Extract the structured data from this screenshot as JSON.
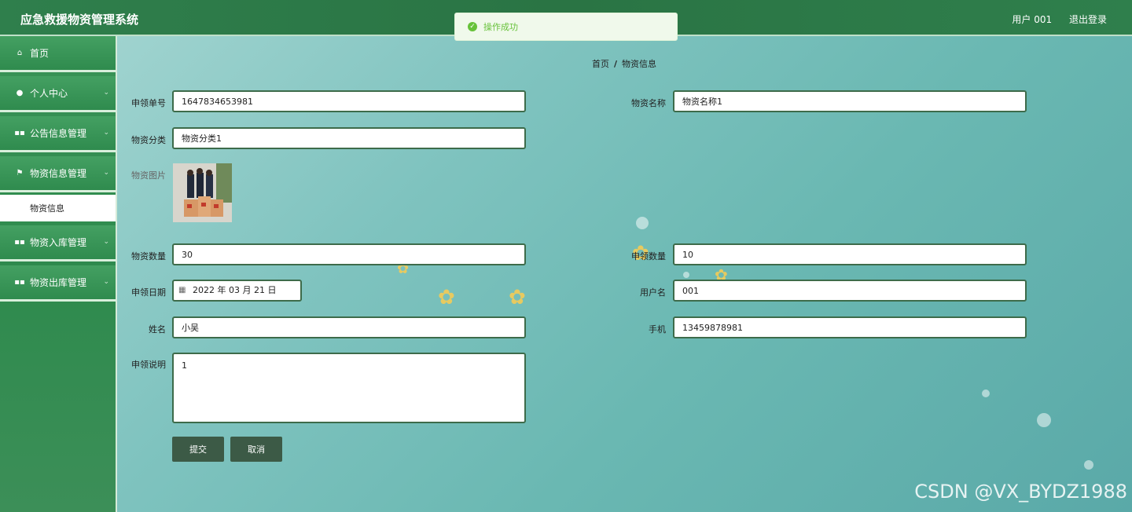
{
  "header": {
    "title": "应急救援物资管理系统",
    "user_label": "用户 001",
    "logout_label": "退出登录"
  },
  "toast": {
    "message": "操作成功"
  },
  "sidebar": {
    "items": [
      {
        "label": "首页",
        "icon": "home-icon"
      },
      {
        "label": "个人中心",
        "icon": "user-icon"
      },
      {
        "label": "公告信息管理",
        "icon": "grid-icon"
      },
      {
        "label": "物资信息管理",
        "icon": "flag-icon"
      },
      {
        "label": "物资入库管理",
        "icon": "grid-icon"
      },
      {
        "label": "物资出库管理",
        "icon": "grid-icon"
      }
    ],
    "sub_item": "物资信息"
  },
  "breadcrumb": {
    "home": "首页",
    "sep": "/",
    "current": "物资信息"
  },
  "form": {
    "order_no": {
      "label": "申领单号",
      "value": "1647834653981"
    },
    "material_name": {
      "label": "物资名称",
      "value": "物资名称1"
    },
    "category": {
      "label": "物资分类",
      "value": "物资分类1"
    },
    "photo": {
      "label": "物资图片"
    },
    "quantity": {
      "label": "物资数量",
      "value": "30"
    },
    "apply_quantity": {
      "label": "申领数量",
      "value": "10"
    },
    "apply_date": {
      "label": "申领日期",
      "value": "2022 年 03 月 21 日"
    },
    "username": {
      "label": "用户名",
      "value": "001"
    },
    "name": {
      "label": "姓名",
      "value": "小吴"
    },
    "phone": {
      "label": "手机",
      "value": "13459878981"
    },
    "remark": {
      "label": "申领说明",
      "value": "1"
    },
    "submit_label": "提交",
    "cancel_label": "取消"
  },
  "watermark": "CSDN @VX_BYDZ1988",
  "colors": {
    "header": "#2f7f4c",
    "input_border": "#3d6b4a",
    "button": "#3c5a46",
    "toast_text": "#67c23a"
  }
}
